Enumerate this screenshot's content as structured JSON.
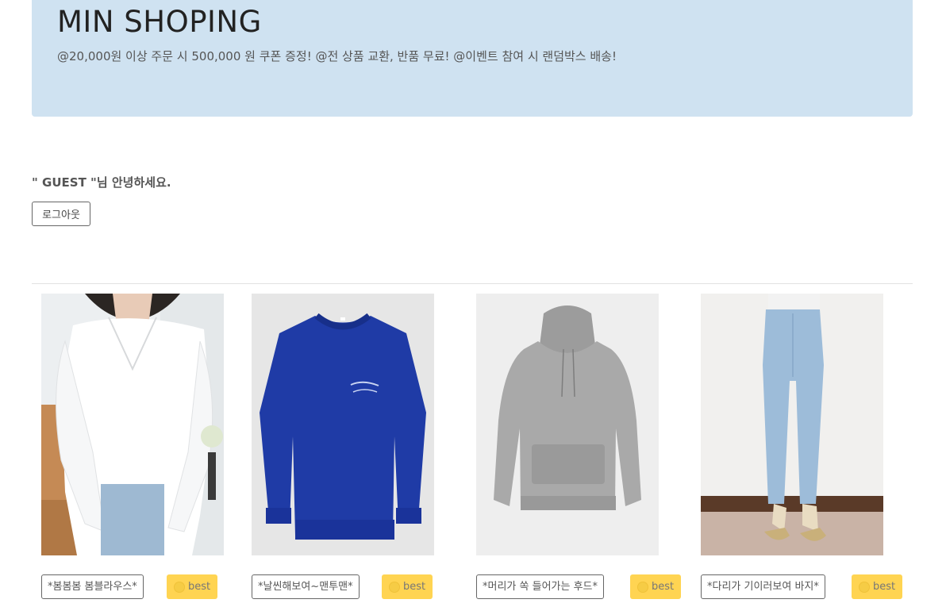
{
  "header": {
    "brand": "MIN SHOPING",
    "promo": "@20,000원 이상 주문 시 500,000 원 쿠폰 증정! @전 상품 교환, 반품 무료! @이벤트 참여 시 랜덤박스 배송!"
  },
  "user": {
    "greeting": "\" GUEST \"님 안녕하세요.",
    "logout_label": "로그아웃"
  },
  "products": [
    {
      "name": "*봄봄봄 봄블라우스*",
      "badge": "best",
      "image": "white-blouse-photo"
    },
    {
      "name": "*날씬해보여~맨투맨*",
      "badge": "best",
      "image": "blue-sweatshirt-photo"
    },
    {
      "name": "*머리가 쏙 들어가는 후드*",
      "badge": "best",
      "image": "gray-hoodie-photo"
    },
    {
      "name": "*다리가 기이러보여 바지*",
      "badge": "best",
      "image": "light-jeans-photo"
    }
  ],
  "icons": {
    "best": "circle-badge-icon"
  },
  "colors": {
    "jumbotron_bg": "#cfe2f1",
    "best_button": "#ffd452"
  }
}
